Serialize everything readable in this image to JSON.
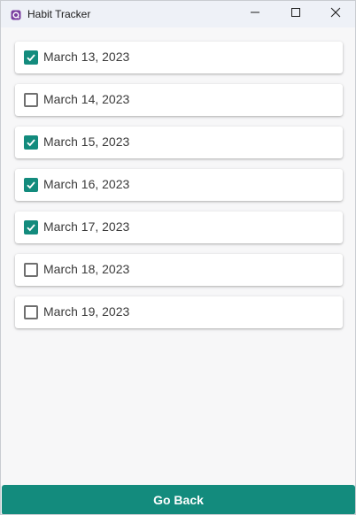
{
  "window": {
    "title": "Habit Tracker",
    "icon": "app-logo-icon",
    "controls": [
      "minimize-icon",
      "maximize-icon",
      "close-icon"
    ]
  },
  "habits": [
    {
      "label": "March 13, 2023",
      "checked": true
    },
    {
      "label": "March 14, 2023",
      "checked": false
    },
    {
      "label": "March 15, 2023",
      "checked": true
    },
    {
      "label": "March 16, 2023",
      "checked": true
    },
    {
      "label": "March 17, 2023",
      "checked": true
    },
    {
      "label": "March 18, 2023",
      "checked": false
    },
    {
      "label": "March 19, 2023",
      "checked": false
    }
  ],
  "footer": {
    "back_label": "Go Back"
  },
  "colors": {
    "accent": "#138b7d",
    "titlebar": "#eef1f7",
    "background": "#f7f7f8"
  }
}
